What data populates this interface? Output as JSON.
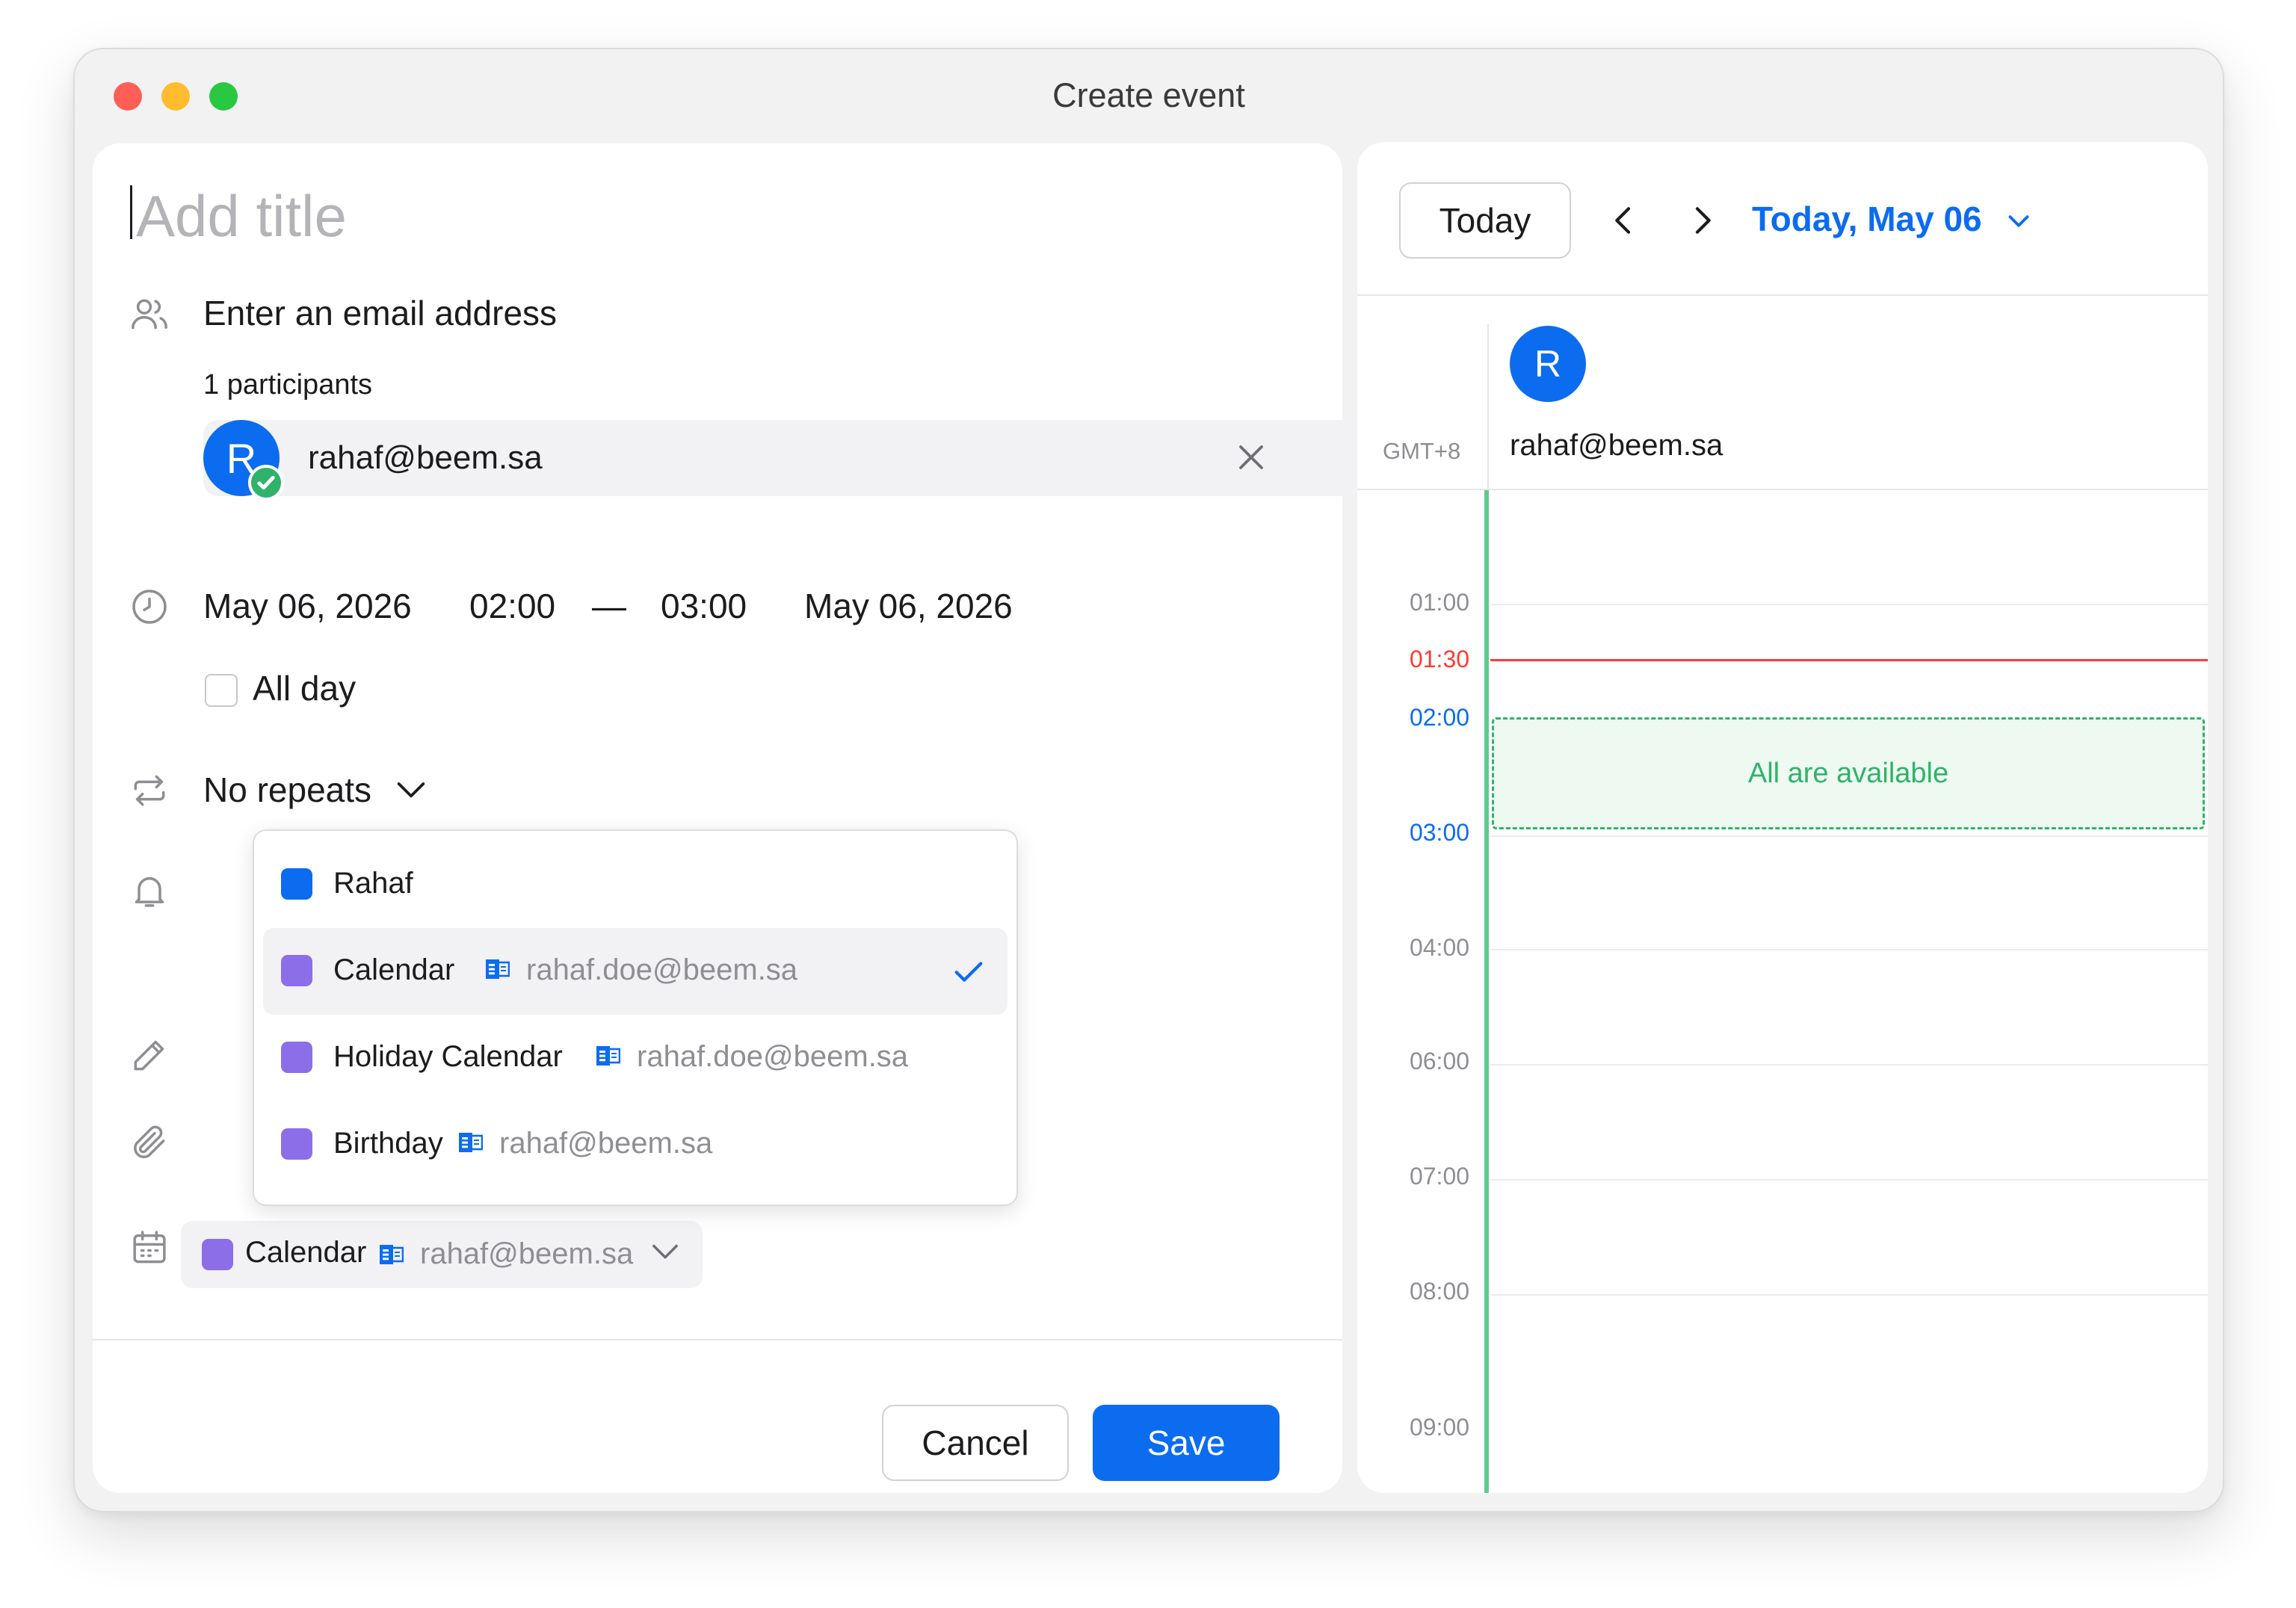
{
  "window": {
    "title": "Create event"
  },
  "form": {
    "title_placeholder": "Add title",
    "email_placeholder": "Enter an email address",
    "participants_count": "1 participants",
    "participant": {
      "initial": "R",
      "email": "rahaf@beem.sa"
    },
    "start_date": "May 06, 2026",
    "start_time": "02:00",
    "time_separator": "—",
    "end_time": "03:00",
    "end_date": "May 06, 2026",
    "all_day_label": "All day",
    "repeat_label": "No repeats",
    "calendar_select": {
      "name": "Calendar",
      "account": "rahaf@beem.sa",
      "color": "#8b6ee8"
    }
  },
  "dropdown": {
    "items": [
      {
        "name": "Rahaf",
        "account": "",
        "color": "#0b6cf0",
        "selected": false
      },
      {
        "name": "Calendar",
        "account": "rahaf.doe@beem.sa",
        "color": "#8b6ee8",
        "selected": true
      },
      {
        "name": "Holiday Calendar",
        "account": "rahaf.doe@beem.sa",
        "color": "#8b6ee8",
        "selected": false
      },
      {
        "name": "Birthday",
        "account": "rahaf@beem.sa",
        "color": "#8b6ee8",
        "selected": false
      }
    ]
  },
  "footer": {
    "cancel_label": "Cancel",
    "save_label": "Save"
  },
  "schedule": {
    "today_label": "Today",
    "date_label": "Today, May 06",
    "timezone": "GMT+8",
    "attendee": {
      "initial": "R",
      "email": "rahaf@beem.sa"
    },
    "times": [
      "01:00",
      "01:30",
      "02:00",
      "03:00",
      "04:00",
      "06:00",
      "07:00",
      "08:00",
      "09:00"
    ],
    "current_time": "01:30",
    "availability_label": "All are available"
  },
  "colors": {
    "accent": "#0b6cf0",
    "now_line": "#ff3b30",
    "available_green": "#2fb36a",
    "calendar_purple": "#8b6ee8"
  }
}
